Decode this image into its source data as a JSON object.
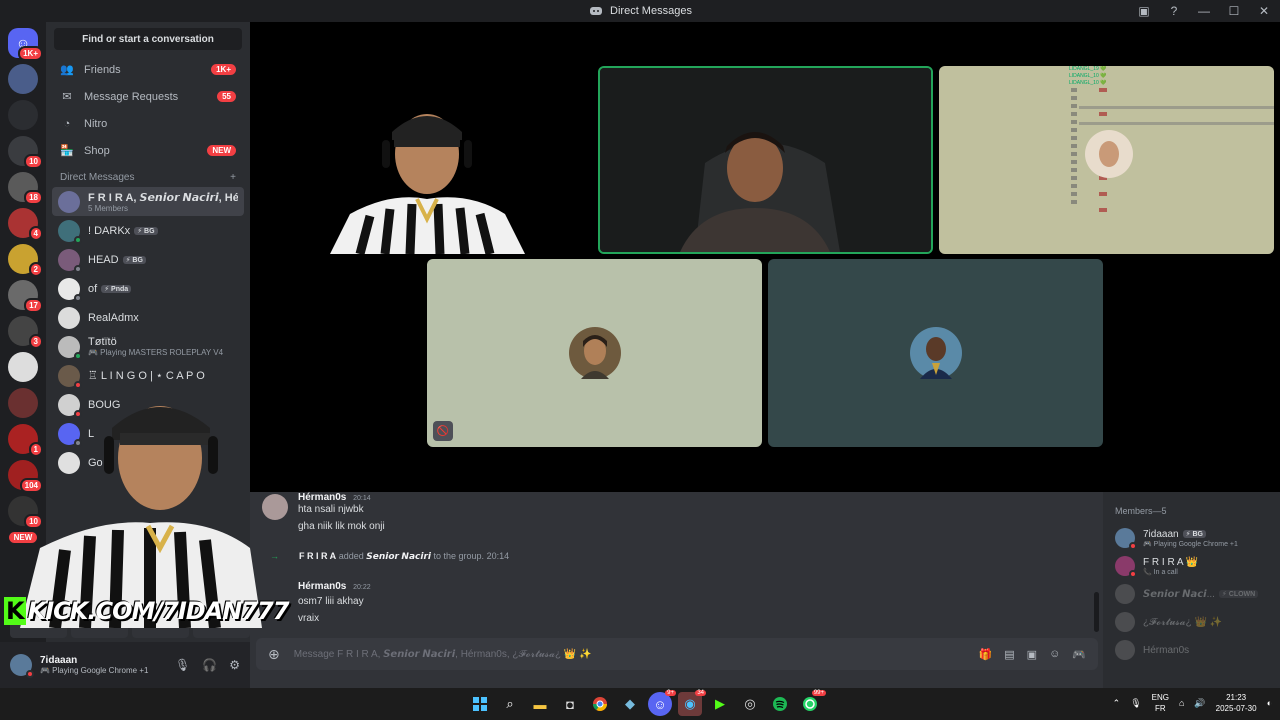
{
  "window": {
    "title": "Direct Messages"
  },
  "servers": [
    {
      "name": "discord-home",
      "badge": "1K+"
    },
    {
      "name": "server-1",
      "badge": ""
    },
    {
      "name": "server-2",
      "badge": ""
    },
    {
      "name": "server-3",
      "badge": "10"
    },
    {
      "name": "server-4",
      "badge": "18"
    },
    {
      "name": "server-5",
      "badge": "4"
    },
    {
      "name": "server-6",
      "badge": "2"
    },
    {
      "name": "server-7",
      "badge": "17"
    },
    {
      "name": "server-8",
      "badge": "3"
    },
    {
      "name": "server-9",
      "badge": ""
    },
    {
      "name": "server-10",
      "badge": ""
    },
    {
      "name": "server-11",
      "badge": "1"
    },
    {
      "name": "server-12",
      "badge": "104"
    },
    {
      "name": "server-13",
      "badge": "10"
    }
  ],
  "rail_new": "NEW",
  "sidebar": {
    "find": "Find or start a conversation",
    "nav": [
      {
        "label": "Friends",
        "count": "1K+",
        "icon": "friends-icon"
      },
      {
        "label": "Message Requests",
        "count": "55",
        "icon": "envelope-icon"
      },
      {
        "label": "Nitro",
        "count": "",
        "icon": "nitro-icon"
      },
      {
        "label": "Shop",
        "count": "NEW",
        "icon": "shop-icon"
      }
    ],
    "dm_header": "Direct Messages",
    "dm_add": "+",
    "dms": [
      {
        "name": "F R I R A, 𝙎𝙚𝙣𝙞𝙤𝙧 𝙉𝙖𝙘𝙞𝙧𝙞, Hér...",
        "sub": "5 Members",
        "tag": "",
        "status": "",
        "color": "#6b6f9a"
      },
      {
        "name": "! DARKx",
        "sub": "",
        "tag": "⚡ BG",
        "status": "on",
        "color": "#3f6f7a"
      },
      {
        "name": "HEAD",
        "sub": "",
        "tag": "⚡ BG",
        "status": "off",
        "color": "#7a5b7a"
      },
      {
        "name": "of",
        "sub": "",
        "tag": "⚡ Pnda",
        "status": "off",
        "color": "#e8e8e8"
      },
      {
        "name": "RealAdmx",
        "sub": "",
        "tag": "",
        "status": "",
        "color": "#dcdcdc"
      },
      {
        "name": "Tøtïtö",
        "sub": "🎮 Playing MASTERS ROLEPLAY V4",
        "tag": "",
        "status": "on",
        "color": "#bbbbbb"
      },
      {
        "name": "♖ L I N G O | ⋆ C A P O",
        "sub": "",
        "tag": "",
        "status": "dnd",
        "color": "#6a5a4a"
      },
      {
        "name": "BOUG",
        "sub": "",
        "tag": "",
        "status": "dnd",
        "color": "#d0d0d0"
      },
      {
        "name": "L",
        "sub": "",
        "tag": "",
        "status": "off",
        "color": "#5865f2"
      },
      {
        "name": "Go",
        "sub": "",
        "tag": "",
        "status": "",
        "color": "#e0e0e0"
      }
    ]
  },
  "user": {
    "name": "7idaaan",
    "status": "🎮 Playing Google Chrome +1"
  },
  "stream_overlay": {
    "kick": "KICK.COM/7IDAN777"
  },
  "call": {
    "chat_overlay_lines": [
      "LIDANGL_19 💚",
      "LIDANGL_10 💚",
      "LIDANGL_10 💚"
    ]
  },
  "messages": [
    {
      "author": "Hérman0s",
      "time": "20:14",
      "lines": [
        "hta nsali njwbk",
        "gha niik lik mok onji"
      ]
    },
    {
      "system": true,
      "actor": "F R I R A",
      "action": "added",
      "target": "𝙎𝙚𝙣𝙞𝙤𝙧 𝙉𝙖𝙘𝙞𝙧𝙞",
      "rest": "to the group.",
      "time": "20:14"
    },
    {
      "author": "Hérman0s",
      "time": "20:22",
      "lines": [
        "osm7 liii akhay",
        "vraix"
      ]
    }
  ],
  "composer": {
    "placeholder": "Message F R I R A, 𝙎𝙚𝙣𝙞𝙤𝙧 𝙉𝙖𝙘𝙞𝙧𝙞, Hérman0s, ¿𝓕𝓸𝓻𝓽𝓾𝓼𝓪¿ 👑 ✨"
  },
  "members": {
    "header": "Members—5",
    "list": [
      {
        "name": "7idaaan",
        "tag": "⚡ BG",
        "sub": "🎮 Playing Google Chrome +1",
        "dim": false,
        "color": "#5a7a9a",
        "status": "dnd"
      },
      {
        "name": "F R I R A 👑",
        "tag": "",
        "sub": "📞 In a call",
        "dim": false,
        "color": "#8a3a6a",
        "status": "dnd"
      },
      {
        "name": "𝙎𝙚𝙣𝙞𝙤𝙧 𝙉𝙖𝙘𝙞...",
        "tag": "⚡ CLOWN",
        "sub": "",
        "dim": true,
        "color": "#888",
        "status": ""
      },
      {
        "name": "¿𝓕𝓸𝓻𝓽𝓾𝓼𝓪¿ 👑 ✨",
        "tag": "",
        "sub": "",
        "dim": true,
        "color": "#888",
        "status": ""
      },
      {
        "name": "Hérman0s",
        "tag": "",
        "sub": "",
        "dim": true,
        "color": "#888",
        "status": ""
      }
    ]
  },
  "taskbar": {
    "lang": "ENG",
    "region": "FR",
    "time": "21:23",
    "date": "2025-07-30",
    "badges": {
      "discord": "9+",
      "app2": "34",
      "whatsapp": "99+"
    }
  }
}
